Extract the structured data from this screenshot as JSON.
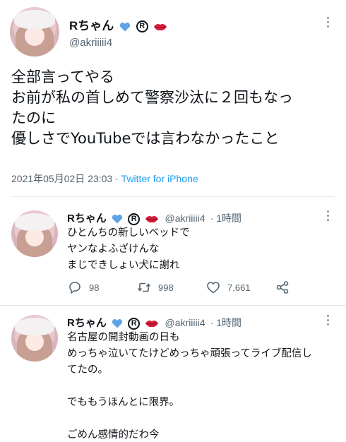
{
  "main_tweet": {
    "display_name": "Rちゃん",
    "handle": "@akriiiii4",
    "lines": [
      "全部言ってやる",
      "お前が私の首しめて警察沙汰に２回もなっ",
      "たのに",
      "優しさでYouTubeでは言わなかったこと"
    ],
    "timestamp": "2021年05月02日 23:03",
    "separator": " · ",
    "source": "Twitter for iPhone"
  },
  "reply1": {
    "display_name": "Rちゃん",
    "handle": "@akriiiii4",
    "time": "· 1時間",
    "lines": [
      "ひとんちの新しいベッドで",
      "ヤンなよふざけんな",
      "まじできしょい犬に謝れ"
    ],
    "reply_count": "98",
    "retweet_count": "998",
    "like_count": "7,661"
  },
  "reply2": {
    "display_name": "Rちゃん",
    "handle": "@akriiiii4",
    "time": "· 1時間",
    "lines": [
      "名古屋の開封動画の日も",
      "めっちゃ泣いてたけどめっちゃ頑張ってライブ配信し",
      "てたの。",
      "",
      "でももうほんとに限界。",
      "",
      "ごめん感情的だわ今"
    ]
  },
  "badges": {
    "blue_heart_color": "#5da3e8",
    "lips_color": "#d81b3c",
    "registered_symbol": "R"
  }
}
